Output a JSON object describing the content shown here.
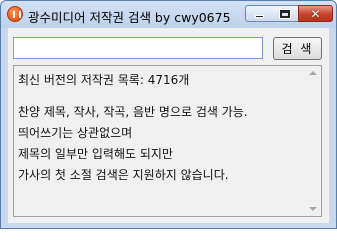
{
  "window": {
    "title": "광수미디어 저작권 검색 by cwy0675",
    "close_glyph": "✕"
  },
  "search": {
    "value": "",
    "placeholder": "",
    "button_label": "검 색"
  },
  "results": {
    "lines": [
      "최신 버전의 저작권 목록: 4716개",
      "찬양 제목, 작사, 작곡, 음반 명으로 검색 가능.",
      "띄어쓰기는 상관없으며",
      "제목의 일부만 입력해도 되지만",
      "가사의 첫 소절 검색은 지원하지 않습니다."
    ]
  },
  "icons": {
    "app": "app-icon",
    "minimize": "minimize-icon",
    "maximize": "maximize-icon",
    "close": "close-icon",
    "scroll_up": "scroll-up-arrow-icon",
    "scroll_down": "scroll-down-arrow-icon"
  },
  "colors": {
    "title_bar": "#c8d9ef",
    "close_button": "#c8432c",
    "input_border": "#7a9cd3"
  }
}
